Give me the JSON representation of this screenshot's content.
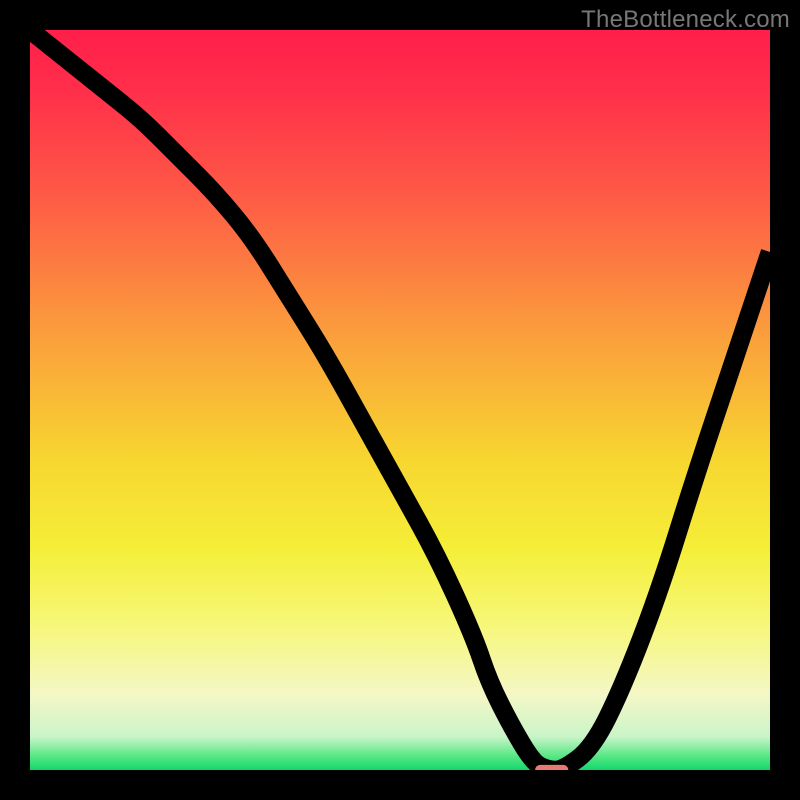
{
  "watermark": "TheBottleneck.com",
  "chart_data": {
    "type": "line",
    "title": "",
    "xlabel": "",
    "ylabel": "",
    "xlim": [
      0,
      100
    ],
    "ylim": [
      0,
      100
    ],
    "grid": false,
    "gradient_stops": [
      {
        "offset": 0.0,
        "color": "#ff1f4a"
      },
      {
        "offset": 0.08,
        "color": "#ff2e4a"
      },
      {
        "offset": 0.22,
        "color": "#fe5946"
      },
      {
        "offset": 0.4,
        "color": "#fb9a3d"
      },
      {
        "offset": 0.58,
        "color": "#f7d630"
      },
      {
        "offset": 0.7,
        "color": "#f5ee38"
      },
      {
        "offset": 0.8,
        "color": "#f6f776"
      },
      {
        "offset": 0.9,
        "color": "#f4f7c7"
      },
      {
        "offset": 0.955,
        "color": "#c9f5c8"
      },
      {
        "offset": 0.98,
        "color": "#5de887"
      },
      {
        "offset": 1.0,
        "color": "#13d86c"
      }
    ],
    "series": [
      {
        "name": "bottleneck-curve",
        "x": [
          0,
          5,
          10,
          15,
          20,
          25,
          30,
          35,
          40,
          45,
          50,
          55,
          60,
          62,
          65,
          68,
          70,
          72,
          76,
          80,
          85,
          90,
          95,
          100
        ],
        "y": [
          100,
          96,
          92,
          88,
          83,
          78,
          72,
          64,
          56,
          47,
          38,
          29,
          18,
          12,
          6,
          1,
          0,
          0,
          3,
          11,
          24,
          40,
          55,
          70
        ]
      }
    ],
    "annotations": {
      "marker": {
        "x": 70.5,
        "y": 0,
        "w": 4.5,
        "h": 1.4,
        "color": "#e77a72"
      }
    }
  }
}
